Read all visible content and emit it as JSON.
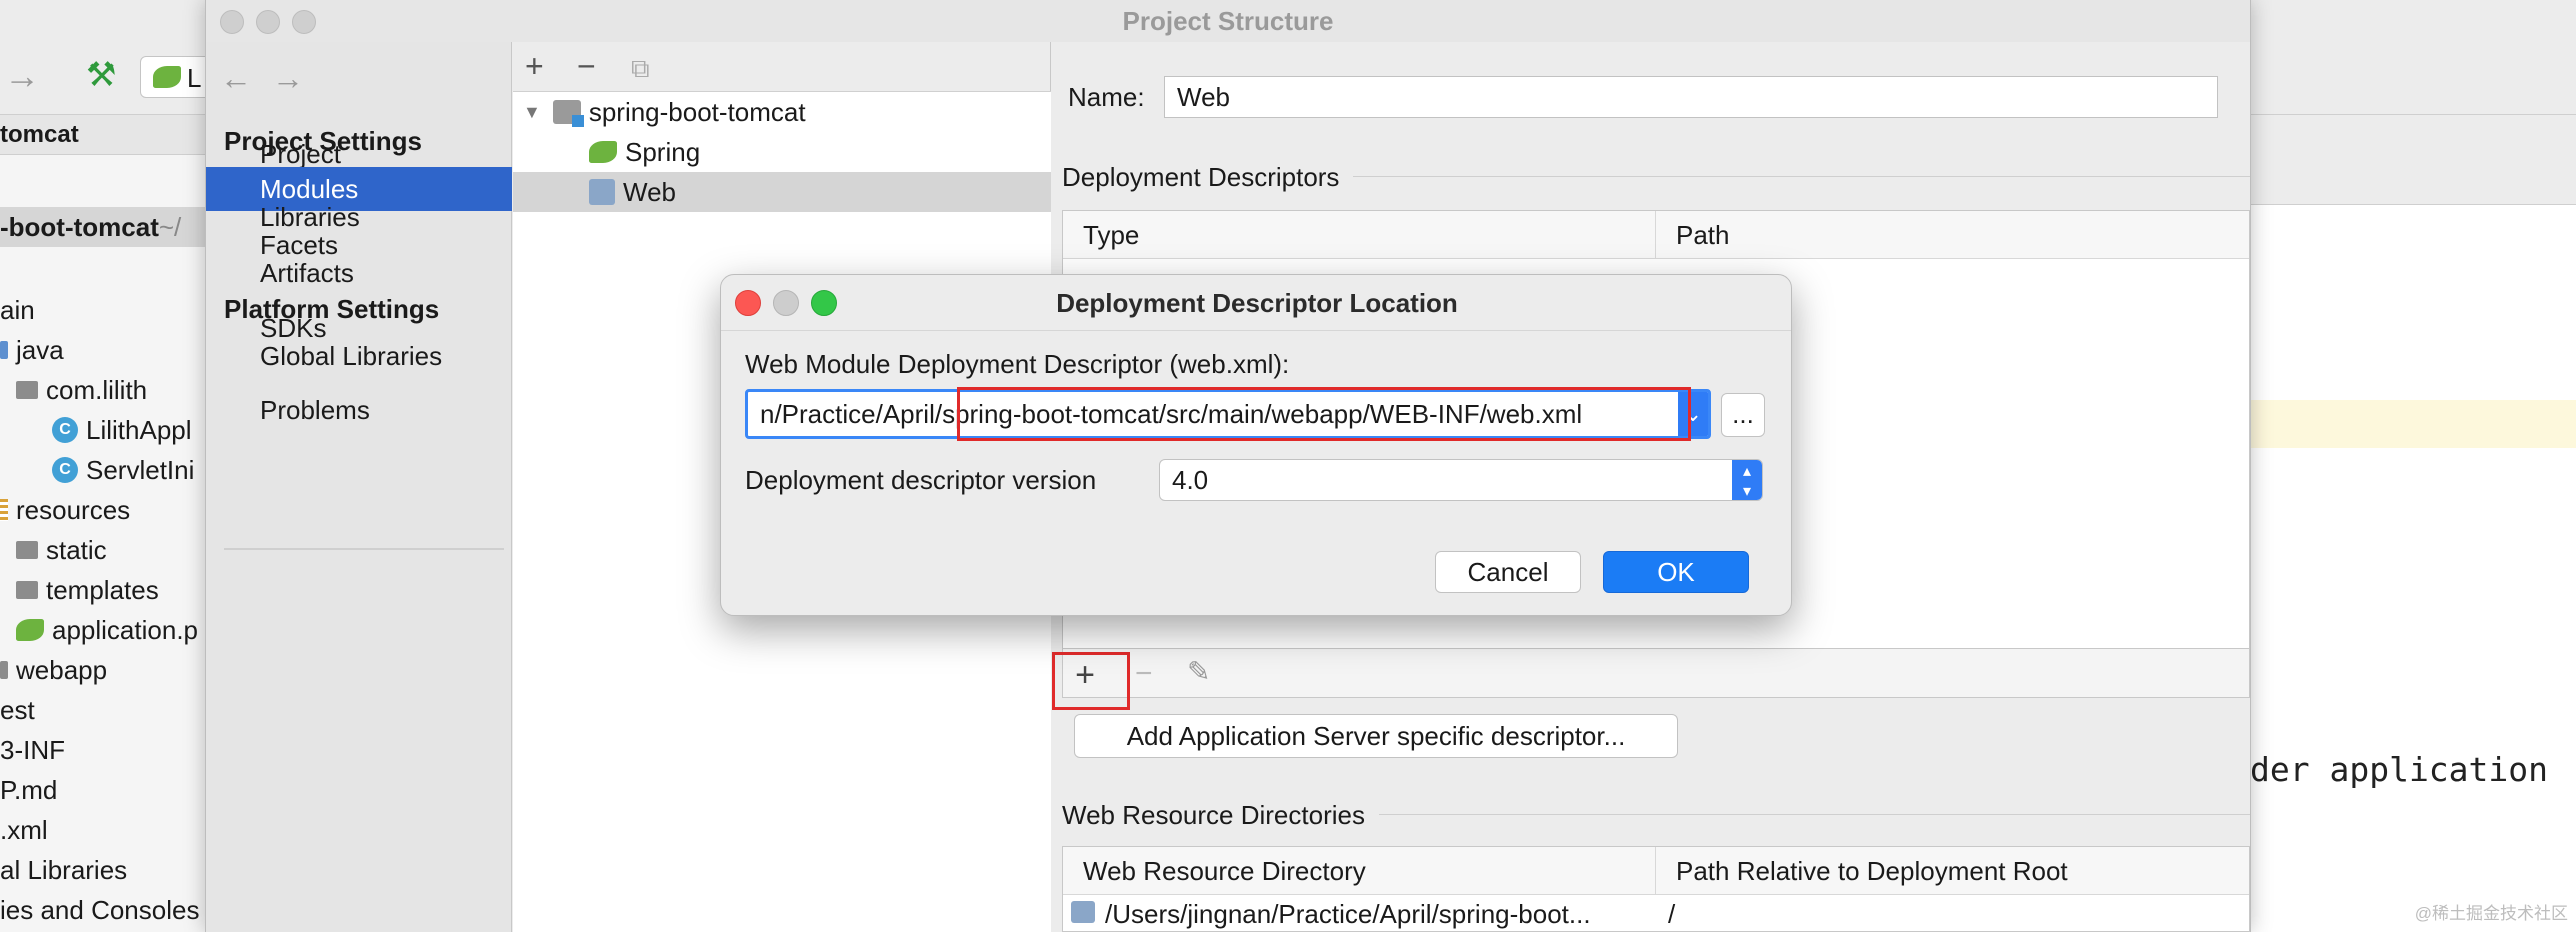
{
  "ide": {
    "project_bar_label": "tomcat",
    "tree": [
      {
        "label": "-boot-tomcat",
        "suffix": " ~/",
        "kind": "root"
      },
      {
        "label": "ain",
        "kind": "plain"
      },
      {
        "label": "java",
        "kind": "blue-folder"
      },
      {
        "label": "com.lilith",
        "kind": "package"
      },
      {
        "label": "LilithAppl",
        "kind": "class"
      },
      {
        "label": "ServletIni",
        "kind": "class"
      },
      {
        "label": "resources",
        "kind": "resources"
      },
      {
        "label": "static",
        "kind": "folder"
      },
      {
        "label": "templates",
        "kind": "folder"
      },
      {
        "label": "application.p",
        "kind": "spring"
      },
      {
        "label": "webapp",
        "kind": "folder"
      },
      {
        "label": "est",
        "kind": "plain"
      },
      {
        "label": "3-INF",
        "kind": "plain"
      },
      {
        "label": "P.md",
        "kind": "plain"
      },
      {
        "label": ".xml",
        "kind": "plain"
      },
      {
        "label": "al Libraries",
        "kind": "plain"
      },
      {
        "label": "ies and Consoles",
        "kind": "plain"
      }
    ],
    "editor_code": "der application",
    "run_config_label": "L",
    "watermark": "@稀土掘金技术社区"
  },
  "window": {
    "title": "Project Structure"
  },
  "sidebar": {
    "project_settings_header": "Project Settings",
    "project_items": [
      {
        "label": "Project",
        "selected": false
      },
      {
        "label": "Modules",
        "selected": true
      },
      {
        "label": "Libraries",
        "selected": false
      },
      {
        "label": "Facets",
        "selected": false
      },
      {
        "label": "Artifacts",
        "selected": false
      }
    ],
    "platform_settings_header": "Platform Settings",
    "platform_items": [
      {
        "label": "SDKs"
      },
      {
        "label": "Global Libraries"
      }
    ],
    "problems_label": "Problems"
  },
  "modules": {
    "tree": [
      {
        "label": "spring-boot-tomcat",
        "kind": "module"
      },
      {
        "label": "Spring",
        "kind": "spring"
      },
      {
        "label": "Web",
        "kind": "web",
        "selected": true
      }
    ]
  },
  "facet": {
    "name_label": "Name:",
    "name_value": "Web",
    "deployment_descriptors_title": "Deployment Descriptors",
    "dd_columns": [
      "Type",
      "Path"
    ],
    "add_server_button": "Add Application Server specific descriptor...",
    "web_resource_title": "Web Resource Directories",
    "wr_columns": [
      "Web Resource Directory",
      "Path Relative to Deployment Root"
    ],
    "wr_rows": [
      {
        "directory": "/Users/jingnan/Practice/April/spring-boot...",
        "relative": "/"
      }
    ]
  },
  "dialog": {
    "title": "Deployment Descriptor Location",
    "descriptor_label": "Web Module Deployment Descriptor (web.xml):",
    "path_value": "n/Practice/April/spring-boot-tomcat/src/main/webapp/WEB-INF/web.xml",
    "browse_label": "...",
    "version_label": "Deployment descriptor version",
    "version_value": "4.0",
    "cancel_label": "Cancel",
    "ok_label": "OK"
  },
  "colors": {
    "selection_blue": "#2f65ca",
    "ok_blue": "#1b7cf5",
    "highlight_red": "#e02a2a",
    "close_red": "#fc5753",
    "zoom_green": "#33c748"
  }
}
